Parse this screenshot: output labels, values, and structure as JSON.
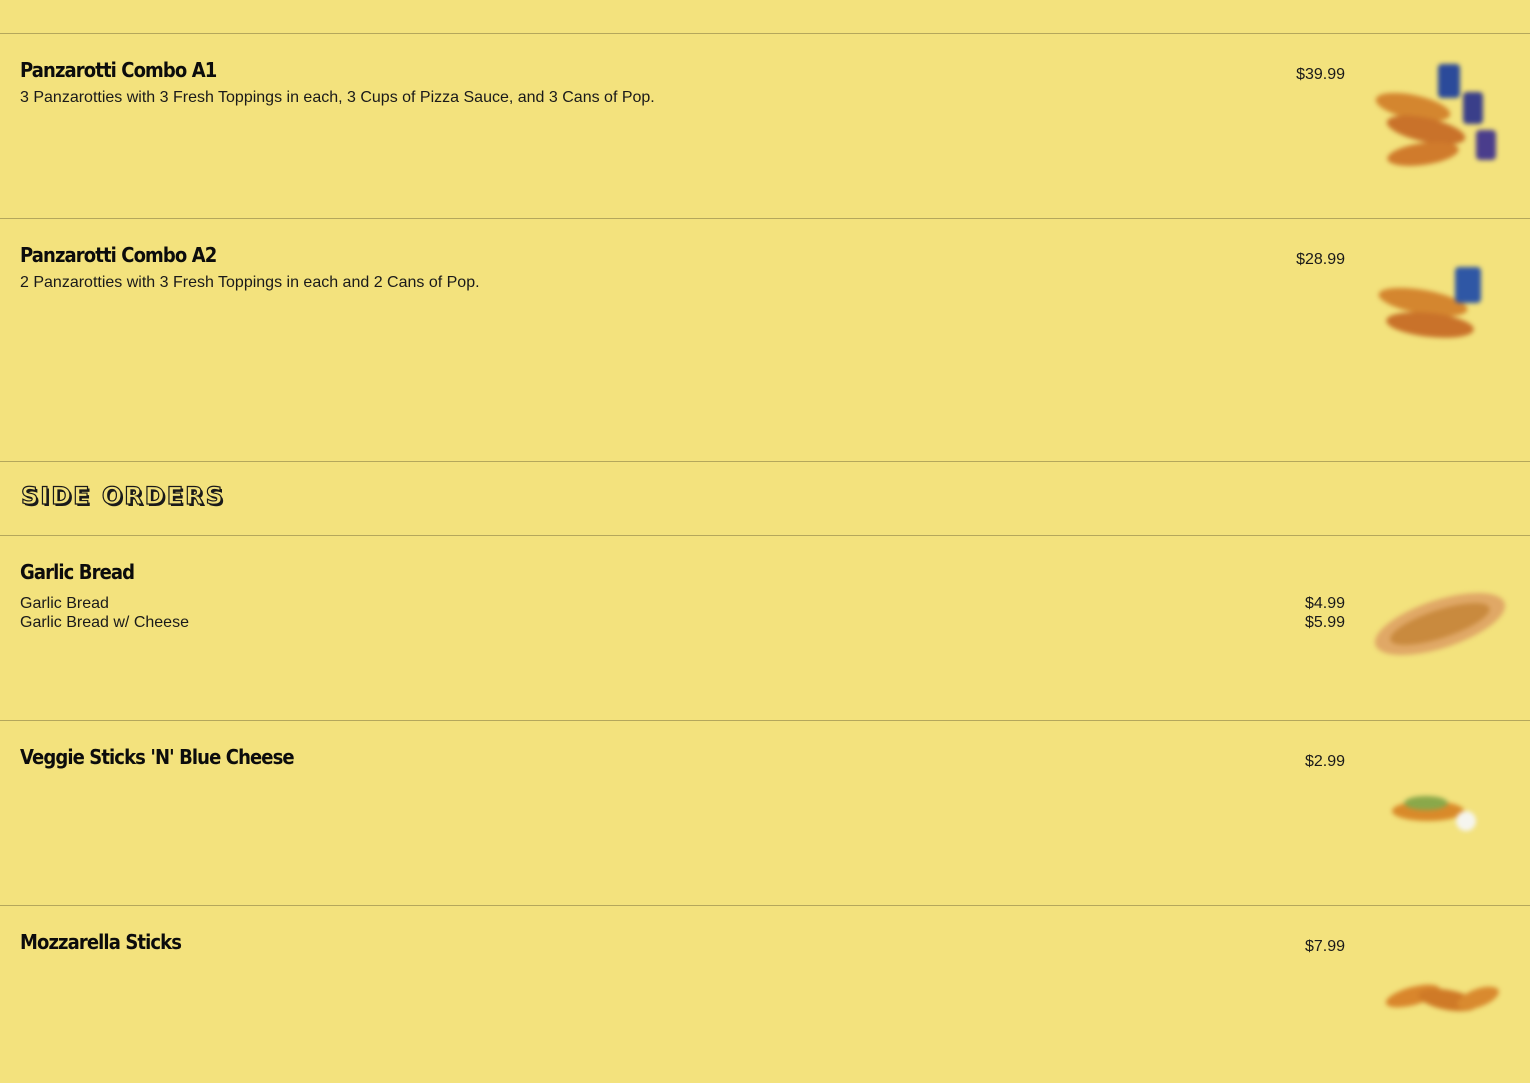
{
  "items": [
    {
      "title": "Panzarotti Combo A1",
      "description": "3 Panzarotties with 3 Fresh Toppings in each, 3 Cups of Pizza Sauce, and 3 Cans of Pop.",
      "price": "$39.99",
      "image_icon": "panzarotti-combo-a1-photo-icon"
    },
    {
      "title": "Panzarotti Combo A2",
      "description": "2 Panzarotties with 3 Fresh Toppings in each and 2 Cans of Pop.",
      "price": "$28.99",
      "image_icon": "panzarotti-combo-a2-photo-icon"
    }
  ],
  "section": {
    "title": "SIDE ORDERS"
  },
  "side_orders": [
    {
      "title": "Garlic Bread",
      "variants": [
        {
          "label": "Garlic Bread",
          "price": "$4.99"
        },
        {
          "label": "Garlic Bread w/ Cheese",
          "price": "$5.99"
        }
      ],
      "image_icon": "garlic-bread-photo-icon"
    },
    {
      "title": "Veggie Sticks 'N' Blue Cheese",
      "price": "$2.99",
      "image_icon": "veggie-sticks-photo-icon"
    },
    {
      "title": "Mozzarella Sticks",
      "price": "$7.99",
      "image_icon": "mozzarella-sticks-photo-icon"
    }
  ],
  "colors": {
    "background": "#f3e27d",
    "divider": "#b4a75c",
    "text": "#111111"
  }
}
